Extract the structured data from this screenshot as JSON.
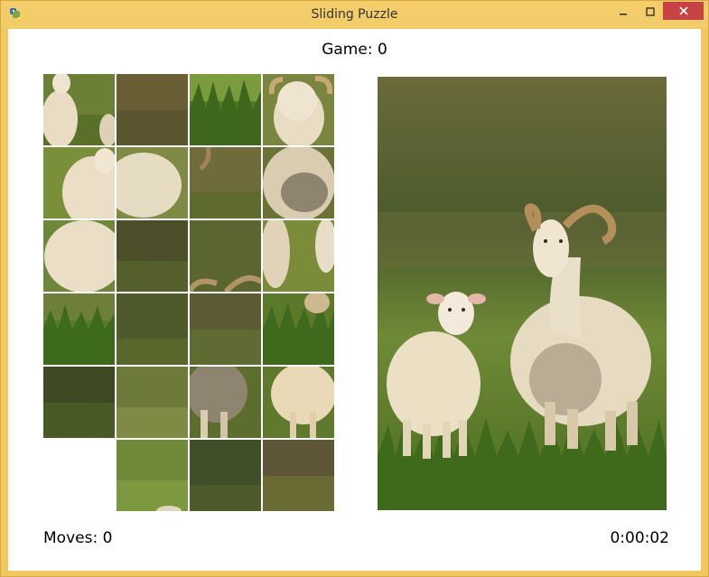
{
  "window": {
    "title": "Sliding Puzzle",
    "app_icon": "python-icon",
    "controls": [
      "minimize-icon",
      "maximize-icon",
      "close-icon"
    ]
  },
  "game": {
    "label": "Game: 0"
  },
  "board": {
    "columns": 4,
    "rows": 6,
    "empty_tile": {
      "row": 5,
      "col": 0
    },
    "tiles_image": "sheep-photo"
  },
  "preview": {
    "image": "sheep-photo"
  },
  "status": {
    "moves": "Moves: 0",
    "timer": "0:00:02"
  },
  "colors": {
    "titlebar": "#f3cd6a",
    "close_button": "#c74343",
    "grass_dark": "#3f5a1e",
    "grass_light": "#7a9a3a",
    "sheep_wool": "#e8dcc4"
  }
}
